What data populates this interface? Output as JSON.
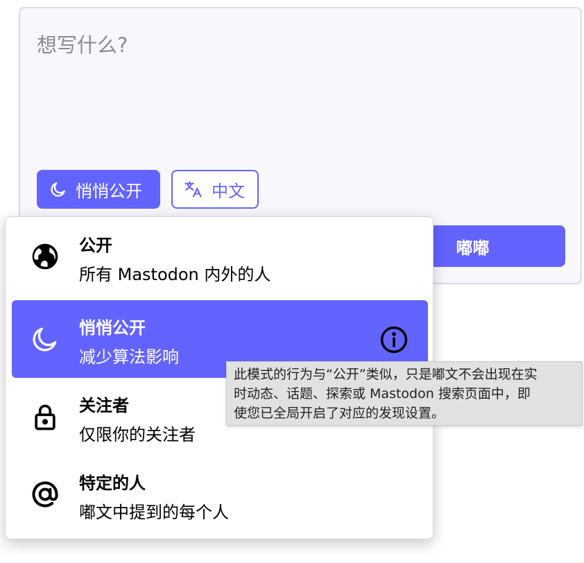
{
  "composer": {
    "placeholder": "想写什么?",
    "visibility_label": "悄悄公开",
    "language_label": "中文",
    "submit_label": "嘟嘟"
  },
  "visibility_options": [
    {
      "title": "公开",
      "description": "所有 Mastodon 内外的人",
      "icon": "globe-icon",
      "selected": false
    },
    {
      "title": "悄悄公开",
      "description": "减少算法影响",
      "icon": "moon-icon",
      "selected": true
    },
    {
      "title": "关注者",
      "description": "仅限你的关注者",
      "icon": "lock-icon",
      "selected": false
    },
    {
      "title": "特定的人",
      "description": "嘟文中提到的每个人",
      "icon": "at-icon",
      "selected": false
    }
  ],
  "tooltip": {
    "lines": [
      "此模式的行为与“公开”类似，只是嘟文不会出现在实",
      "时动态、话题、探索或 Mastodon 搜索页面中，即",
      "使您已全局开启了对应的发现设置。"
    ]
  },
  "colors": {
    "accent": "#6364ff",
    "composer_bg": "#f7f7fc",
    "tooltip_bg": "#e1e1e1"
  }
}
